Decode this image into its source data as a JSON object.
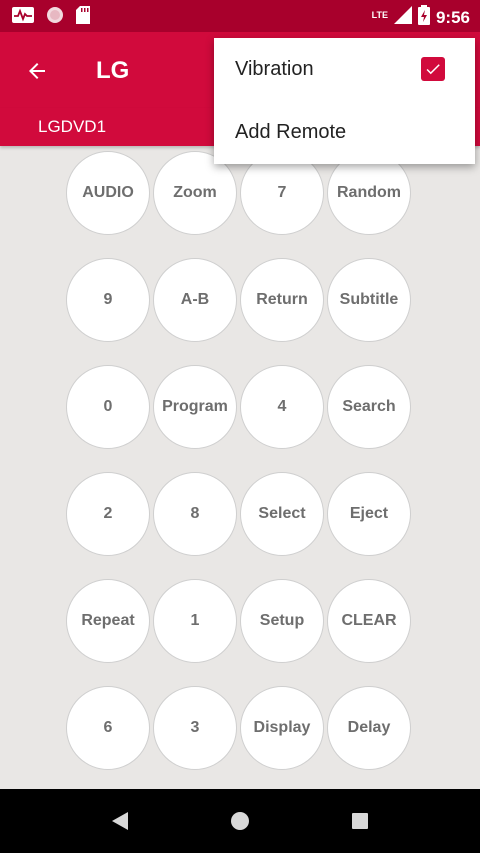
{
  "status_bar": {
    "time": "9:56",
    "network": "LTE",
    "icons": [
      "activity-icon",
      "circle-icon",
      "sd-card-icon",
      "signal-icon",
      "battery-charging-icon"
    ]
  },
  "app_bar": {
    "title": "LG",
    "device": "LGDVD1"
  },
  "menu": {
    "items": [
      {
        "label": "Vibration",
        "checked": true
      },
      {
        "label": "Add Remote"
      }
    ]
  },
  "keys": [
    [
      "AUDIO",
      "Zoom",
      "7",
      "Random"
    ],
    [
      "9",
      "A-B",
      "Return",
      "Subtitle"
    ],
    [
      "0",
      "Program",
      "4",
      "Search"
    ],
    [
      "2",
      "8",
      "Select",
      "Eject"
    ],
    [
      "Repeat",
      "1",
      "Setup",
      "CLEAR"
    ],
    [
      "6",
      "3",
      "Display",
      "Delay"
    ]
  ],
  "colors": {
    "accent": "#d10a3c",
    "status_bar": "#a8002c",
    "background": "#e9e7e5"
  }
}
